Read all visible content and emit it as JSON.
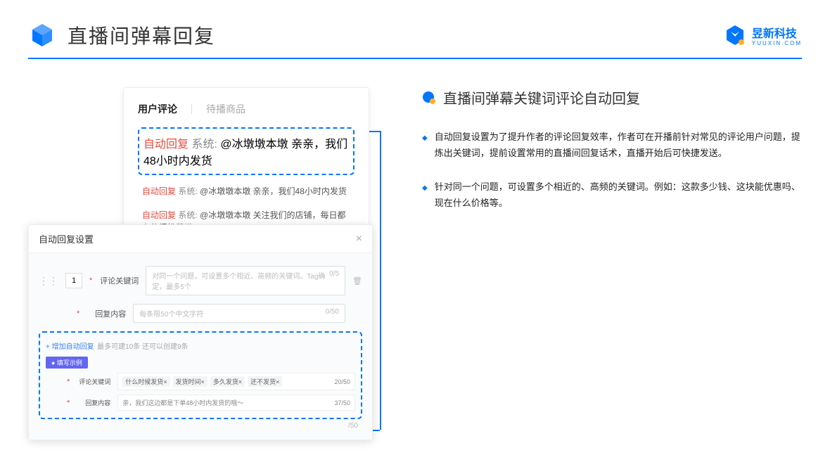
{
  "header": {
    "title": "直播间弹幕回复",
    "brand": "昱新科技",
    "brand_sub": "YUUXIN.COM"
  },
  "comment_card": {
    "tab1": "用户评论",
    "tab2": "待播商品",
    "rows": [
      {
        "badge": "自动回复",
        "sys": "系统: ",
        "text": "@冰墩墩本墩 亲亲，我们48小时内发货"
      },
      {
        "badge": "自动回复",
        "sys": "系统: ",
        "text": "@冰墩墩本墩 亲亲，我们48小时内发货"
      },
      {
        "badge": "自动回复",
        "sys": "系统: ",
        "text": "@冰墩墩本墩 关注我们的店铺，每日都有热门推荐呦～"
      }
    ]
  },
  "settings": {
    "title": "自动回复设置",
    "num": "1",
    "label_keyword": "评论关键词",
    "placeholder_keyword": "对同一个问题，可设置多个相近、高频的关键词。Tag确定，最多5个",
    "count_keyword": "0/5",
    "label_content": "回复内容",
    "placeholder_content": "每条限50个中文字符",
    "count_content": "0/50",
    "add": "+ 增加自动回复",
    "hint": "最多可建10条 还可以创建9条",
    "example_badge": "● 填写示例",
    "ex_label_kw": "评论关键词",
    "ex_tags": [
      "什么时候发货×",
      "发货时间×",
      "多久发货×",
      "还不发货×"
    ],
    "ex_count_kw": "20/50",
    "ex_label_ct": "回复内容",
    "ex_content": "亲，我们这边都是下单48小时内发货的哦～",
    "ex_count_ct": "37/50",
    "outer_count": "/50"
  },
  "right": {
    "title": "直播间弹幕关键词评论自动回复",
    "bullet1": "自动回复设置为了提升作者的评论回复效率，作者可在开播前针对常见的评论用户问题，提炼出关键词，提前设置常用的直播间回复话术，直播开始后可快捷发送。",
    "bullet2": "针对同一个问题，可设置多个相近的、高频的关键词。例如：这款多少钱、这块能优惠吗、现在什么价格等。"
  }
}
